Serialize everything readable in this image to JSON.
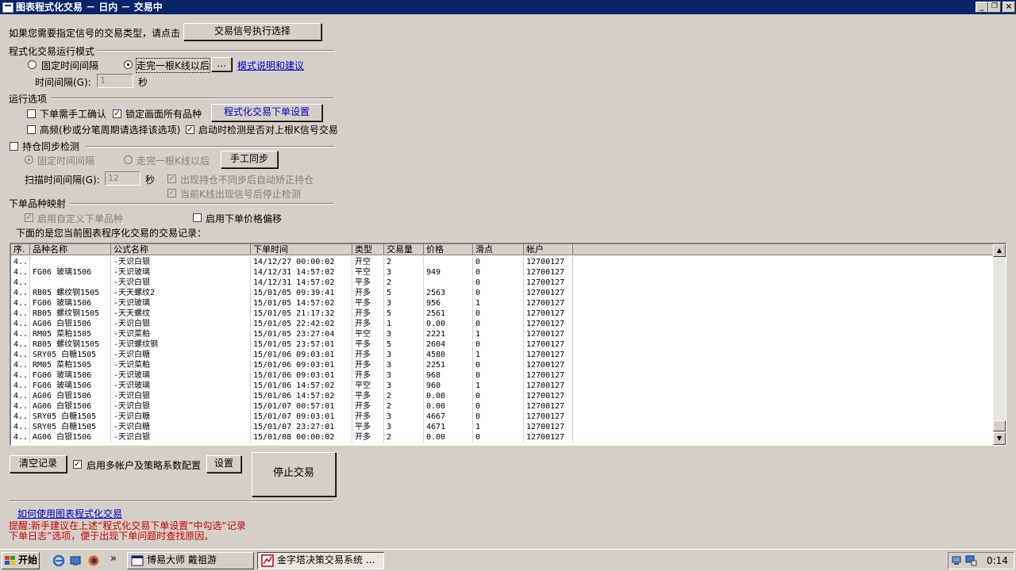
{
  "window": {
    "title": "图表程式化交易 － 日内 － 交易中",
    "minimize": "_",
    "restore": "❐",
    "close": "×"
  },
  "signal_prompt": "如果您需要指定信号的交易类型，请点击",
  "signal_button": "交易信号执行选择",
  "run_mode": {
    "title": "程式化交易运行模式",
    "fixed_interval": "固定时间间隔",
    "after_kline": "走完一根K线以后",
    "ellipsis_button": "...",
    "help_link": "模式说明和建议",
    "interval_label": "时间间隔(G):",
    "interval_value": "1",
    "interval_unit": "秒"
  },
  "run_options": {
    "title": "运行选项",
    "manual_confirm": "下单需手工确认",
    "lock_all": "锁定画面所有品种",
    "order_settings_button": "程式化交易下单设置",
    "high_freq": "高频(秒或分笔周期请选择该选项)",
    "check_on_start": "启动时检测是否对上根K信号交易"
  },
  "sync": {
    "title": "持仓同步检测",
    "fixed_interval": "固定时间间隔",
    "after_kline": "走完一根K线以后",
    "manual_sync_button": "手工同步",
    "scan_label": "扫描时间间隔(G):",
    "scan_value": "12",
    "scan_unit": "秒",
    "auto_fix": "出现持仓不同步后自动矫正持仓",
    "stop_check": "当前K线出现信号后停止检测"
  },
  "mapping": {
    "title": "下单品种映射",
    "custom_symbol": "启用自定义下单品种",
    "price_offset": "启用下单价格偏移"
  },
  "records_caption": "下面的是您当前图表程序化交易的交易记录：",
  "grid": {
    "columns": [
      "序.",
      "品种名称",
      "公式名称",
      "下单时间",
      "类型",
      "交易量",
      "价格",
      "滑点",
      "帐户"
    ],
    "rows": [
      [
        "4..",
        "",
        "-天识白银",
        "14/12/27 00:00:02",
        "开空",
        "2",
        "",
        "0",
        "12700127"
      ],
      [
        "4..",
        "FG06 玻璃1506",
        "-天识玻璃",
        "14/12/31 14:57:02",
        "平空",
        "3",
        "949",
        "0",
        "12700127"
      ],
      [
        "4..",
        "",
        "-天识白银",
        "14/12/31 14:57:02",
        "平多",
        "2",
        "",
        "0",
        "12700127"
      ],
      [
        "4..",
        "RB05 螺纹钢1505",
        "-天天螺纹2",
        "15/01/05 09:39:41",
        "开多",
        "5",
        "2563",
        "0",
        "12700127"
      ],
      [
        "4..",
        "FG06 玻璃1506",
        "-天识玻璃",
        "15/01/05 14:57:02",
        "平多",
        "3",
        "956",
        "1",
        "12700127"
      ],
      [
        "4..",
        "RB05 螺纹钢1505",
        "-天天螺纹",
        "15/01/05 21:17:32",
        "开多",
        "5",
        "2561",
        "0",
        "12700127"
      ],
      [
        "4..",
        "AG06 白银1506",
        "-天识白银",
        "15/01/05 22:42:02",
        "开多",
        "1",
        "0.00",
        "0",
        "12700127"
      ],
      [
        "4..",
        "RM05 菜粕1505",
        "-天识菜粕",
        "15/01/05 23:27:04",
        "平空",
        "3",
        "2221",
        "1",
        "12700127"
      ],
      [
        "4..",
        "RB05 螺纹钢1505",
        "-天识螺纹钢",
        "15/01/05 23:57:01",
        "平多",
        "5",
        "2604",
        "0",
        "12700127"
      ],
      [
        "4..",
        "SRY05 白糖1505",
        "-天识白糖",
        "15/01/06 09:03:01",
        "开多",
        "3",
        "4580",
        "1",
        "12700127"
      ],
      [
        "4..",
        "RM05 菜粕1505",
        "-天识菜粕",
        "15/01/06 09:03:01",
        "开多",
        "3",
        "2251",
        "0",
        "12700127"
      ],
      [
        "4..",
        "FG06 玻璃1506",
        "-天识玻璃",
        "15/01/06 09:03:01",
        "开多",
        "3",
        "968",
        "0",
        "12700127"
      ],
      [
        "4..",
        "FG06 玻璃1506",
        "-天识玻璃",
        "15/01/06 14:57:02",
        "平空",
        "3",
        "960",
        "1",
        "12700127"
      ],
      [
        "4..",
        "AG06 白银1506",
        "-天识白银",
        "15/01/06 14:57:02",
        "平多",
        "2",
        "0.00",
        "0",
        "12700127"
      ],
      [
        "4..",
        "AG06 白银1506",
        "-天识白银",
        "15/01/07 00:57:01",
        "开多",
        "2",
        "0.00",
        "0",
        "12700127"
      ],
      [
        "4..",
        "SRY05 白糖1505",
        "-天识白糖",
        "15/01/07 09:03:01",
        "开多",
        "3",
        "4667",
        "0",
        "12700127"
      ],
      [
        "4..",
        "SRY05 白糖1505",
        "-天识白糖",
        "15/01/07 23:27:01",
        "平多",
        "3",
        "4671",
        "1",
        "12700127"
      ],
      [
        "4..",
        "AG06 白银1506",
        "-天识白银",
        "15/01/08 00:00:02",
        "开多",
        "2",
        "0.00",
        "0",
        "12700127"
      ]
    ]
  },
  "bottom": {
    "clear_button": "清空记录",
    "multi_account": "启用多帐户及策略系数配置",
    "settings_button": "设置",
    "stop_button": "停止交易"
  },
  "how_to_link": "如何使用图表程式化交易",
  "warning_line1": "提醒:新手建议在上述“程式化交易下单设置”中勾选“记录",
  "warning_line2": "下单日志”选项，便于出现下单问题时查找原因。",
  "taskbar": {
    "start": "开始",
    "more": "»",
    "task1": "博易大师 戴祖游",
    "task2": "金字塔决策交易系统 ...",
    "clock": "0:14"
  }
}
